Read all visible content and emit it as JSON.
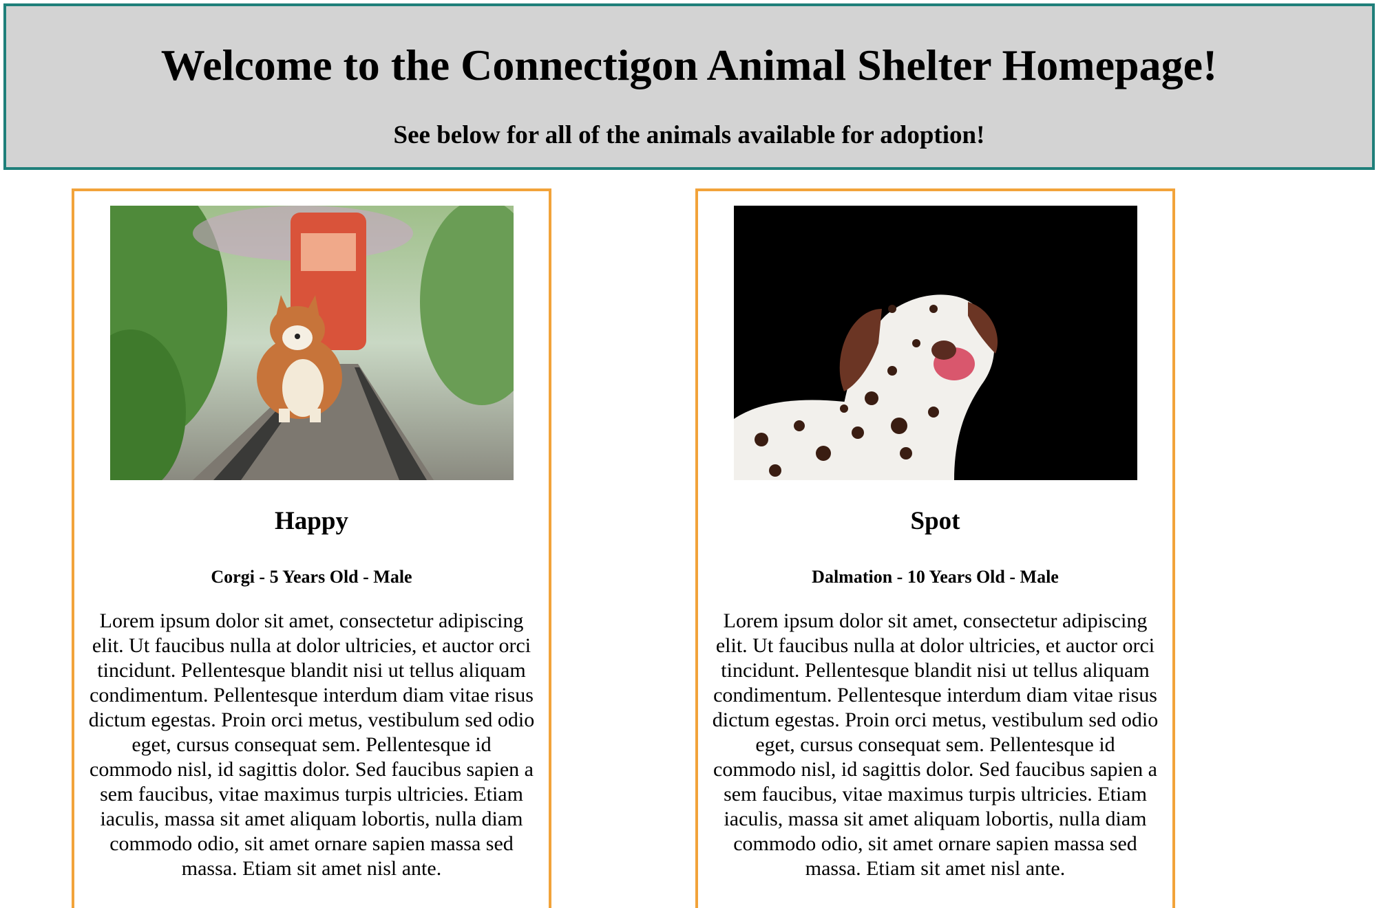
{
  "header": {
    "title": "Welcome to the Connectigon Animal Shelter Homepage!",
    "subtitle": "See below for all of the animals available for adoption!"
  },
  "colors": {
    "header_border": "#1f7f7a",
    "header_background": "#d3d3d3",
    "card_border": "#f2a33a"
  },
  "animals": [
    {
      "name": "Happy",
      "info": "Corgi - 5 Years Old - Male",
      "photo_icon": "corgi-photo",
      "description": "Lorem ipsum dolor sit amet, consectetur adipiscing elit. Ut faucibus nulla at dolor ultricies, et auctor orci tincidunt. Pellentesque blandit nisi ut tellus aliquam condimentum. Pellentesque interdum diam vitae risus dictum egestas. Proin orci metus, vestibulum sed odio eget, cursus consequat sem. Pellentesque id commodo nisl, id sagittis dolor. Sed faucibus sapien a sem faucibus, vitae maximus turpis ultricies. Etiam iaculis, massa sit amet aliquam lobortis, nulla diam commodo odio, sit amet ornare sapien massa sed massa. Etiam sit amet nisl ante."
    },
    {
      "name": "Spot",
      "info": "Dalmation - 10 Years Old - Male",
      "photo_icon": "dalmatian-photo",
      "description": "Lorem ipsum dolor sit amet, consectetur adipiscing elit. Ut faucibus nulla at dolor ultricies, et auctor orci tincidunt. Pellentesque blandit nisi ut tellus aliquam condimentum. Pellentesque interdum diam vitae risus dictum egestas. Proin orci metus, vestibulum sed odio eget, cursus consequat sem. Pellentesque id commodo nisl, id sagittis dolor. Sed faucibus sapien a sem faucibus, vitae maximus turpis ultricies. Etiam iaculis, massa sit amet aliquam lobortis, nulla diam commodo odio, sit amet ornare sapien massa sed massa. Etiam sit amet nisl ante."
    }
  ]
}
